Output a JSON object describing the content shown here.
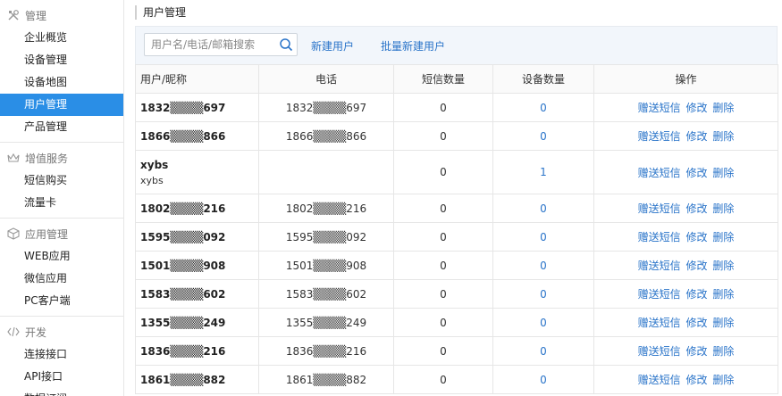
{
  "sidebar": {
    "sections": [
      {
        "title": "管理",
        "icon": "tools-icon",
        "items": [
          "企业概览",
          "设备管理",
          "设备地图",
          "用户管理",
          "产品管理"
        ]
      },
      {
        "title": "增值服务",
        "icon": "crown-icon",
        "items": [
          "短信购买",
          "流量卡"
        ]
      },
      {
        "title": "应用管理",
        "icon": "cube-icon",
        "items": [
          "WEB应用",
          "微信应用",
          "PC客户端"
        ]
      },
      {
        "title": "开发",
        "icon": "code-icon",
        "items": [
          "连接接口",
          "API接口",
          "数据订阅"
        ]
      }
    ],
    "active": "用户管理"
  },
  "main": {
    "title": "用户管理",
    "search": {
      "placeholder": "用户名/电话/邮箱搜索",
      "value": ""
    },
    "actions": {
      "new_user": "新建用户",
      "batch_new_user": "批量新建用户"
    }
  },
  "table": {
    "headers": [
      "用户/昵称",
      "电话",
      "短信数量",
      "设备数量",
      "操作"
    ],
    "ops": [
      "赠送短信",
      "修改",
      "删除"
    ],
    "rows": [
      {
        "user": "1832▒▒▒▒697",
        "nickname": "",
        "phone": "1832▒▒▒▒697",
        "sms": "0",
        "devices": "0"
      },
      {
        "user": "1866▒▒▒▒866",
        "nickname": "",
        "phone": "1866▒▒▒▒866",
        "sms": "0",
        "devices": "0"
      },
      {
        "user": "xybs",
        "nickname": "xybs",
        "phone": "",
        "sms": "0",
        "devices": "1"
      },
      {
        "user": "1802▒▒▒▒216",
        "nickname": "",
        "phone": "1802▒▒▒▒216",
        "sms": "0",
        "devices": "0"
      },
      {
        "user": "1595▒▒▒▒092",
        "nickname": "",
        "phone": "1595▒▒▒▒092",
        "sms": "0",
        "devices": "0"
      },
      {
        "user": "1501▒▒▒▒908",
        "nickname": "",
        "phone": "1501▒▒▒▒908",
        "sms": "0",
        "devices": "0"
      },
      {
        "user": "1583▒▒▒▒602",
        "nickname": "",
        "phone": "1583▒▒▒▒602",
        "sms": "0",
        "devices": "0"
      },
      {
        "user": "1355▒▒▒▒249",
        "nickname": "",
        "phone": "1355▒▒▒▒249",
        "sms": "0",
        "devices": "0"
      },
      {
        "user": "1836▒▒▒▒216",
        "nickname": "",
        "phone": "1836▒▒▒▒216",
        "sms": "0",
        "devices": "0"
      },
      {
        "user": "1861▒▒▒▒882",
        "nickname": "",
        "phone": "1861▒▒▒▒882",
        "sms": "0",
        "devices": "0"
      }
    ]
  },
  "colors": {
    "accent": "#2a8ee6",
    "link": "#2a74c9"
  }
}
